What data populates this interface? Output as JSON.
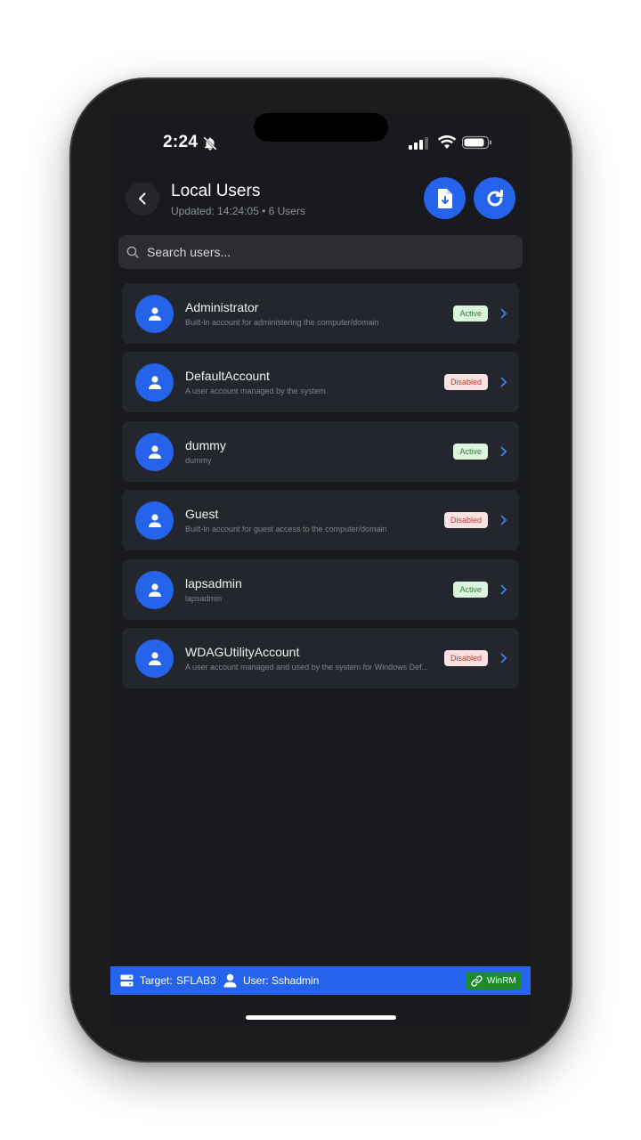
{
  "status_bar": {
    "time": "2:24"
  },
  "header": {
    "title": "Local Users",
    "subtitle": "Updated: 14:24:05 • 6 Users"
  },
  "search": {
    "placeholder": "Search users..."
  },
  "users": [
    {
      "name": "Administrator",
      "description": "Built-in account for administering the computer/domain",
      "status": "Active"
    },
    {
      "name": "DefaultAccount",
      "description": "A user account managed by the system.",
      "status": "Disabled"
    },
    {
      "name": "dummy",
      "description": "dummy",
      "status": "Active"
    },
    {
      "name": "Guest",
      "description": "Built-in account for guest access to the computer/domain",
      "status": "Disabled"
    },
    {
      "name": "lapsadmin",
      "description": "lapsadmin",
      "status": "Active"
    },
    {
      "name": "WDAGUtilityAccount",
      "description": "A user account managed and used by the system for Windows Def...",
      "status": "Disabled"
    }
  ],
  "footer": {
    "target_label": "Target:",
    "target_value": "SFLAB3",
    "user_label": "User:",
    "user_value": "Sshadmin",
    "protocol": "WinRM"
  },
  "colors": {
    "accent": "#2563eb",
    "active_badge": "#dcf5dd",
    "disabled_badge": "#fde2e2",
    "winrm_badge": "#1a8a2b"
  }
}
